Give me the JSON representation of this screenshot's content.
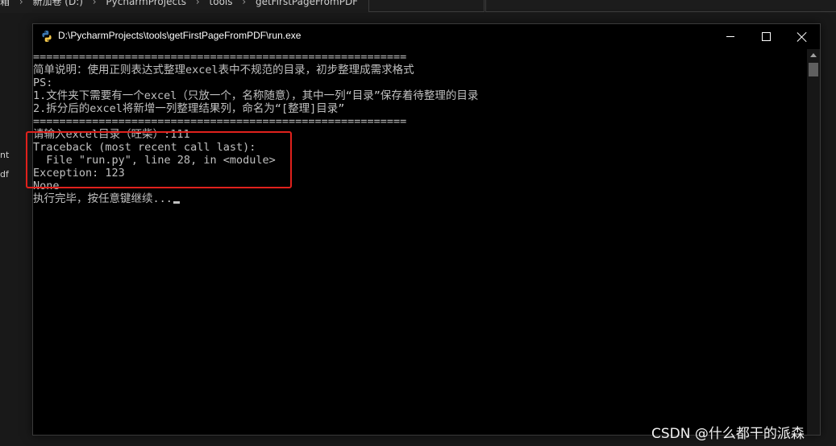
{
  "explorer": {
    "breadcrumbs": [
      "箱",
      "新加卷 (D:)",
      "PycharmProjects",
      "tools",
      "getFirstPageFromPDF"
    ],
    "breadcrumb_separator": "›",
    "side_fragments": [
      "nt",
      "df"
    ]
  },
  "window": {
    "title": "D:\\PycharmProjects\\tools\\getFirstPageFromPDF\\run.exe",
    "icon": "python-icon"
  },
  "console": {
    "lines": [
      "=========================================================",
      "简单说明：使用正则表达式整理excel表中不规范的目录，初步整理成需求格式",
      "PS:",
      "1.文件夹下需要有一个excel（只放一个，名称随意），其中一列“目录”保存着待整理的目录",
      "2.拆分后的excel将新增一列整理结果列，命名为“[整理]目录”",
      "=========================================================",
      "请输入excel目录（旺柴）:111",
      "Traceback (most recent call last):",
      "  File \"run.py\", line 28, in <module>",
      "Exception: 123",
      "None",
      "执行完毕，按任意键继续..."
    ]
  },
  "watermark": "CSDN @什么都干的派森",
  "colors": {
    "console_bg": "#000000",
    "console_text": "#c0c0c0",
    "highlight": "#e0211c"
  }
}
